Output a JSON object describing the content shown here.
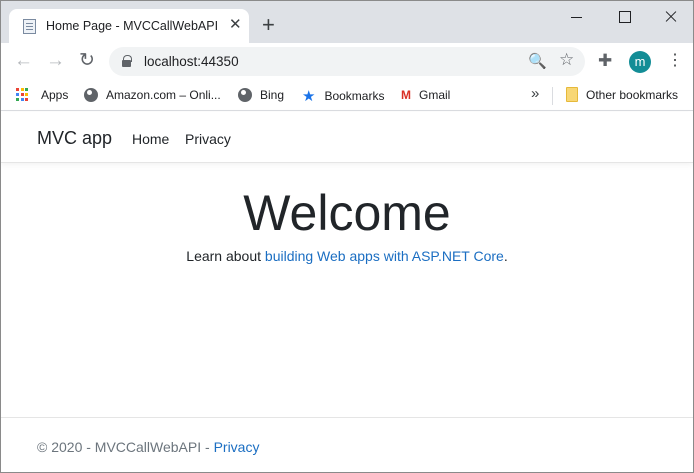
{
  "browser": {
    "tab_title": "Home Page - MVCCallWebAPI",
    "tab_close": "✕",
    "new_tab": "+",
    "url": "localhost:44350",
    "profile_initial": "m",
    "back": "←",
    "forward": "→",
    "reload": "↻",
    "zoom": "🔍",
    "star": "☆",
    "extensions": "✚",
    "menu": "⋮",
    "bookmarks": {
      "apps": "Apps",
      "amazon": "Amazon.com – Onli...",
      "bing": "Bing",
      "bookmarks": "Bookmarks",
      "gmail": "Gmail",
      "more": "»",
      "other": "Other bookmarks"
    },
    "icons": {
      "apps": "apps-grid-icon",
      "amazon": "globe-icon",
      "bing": "globe-icon",
      "bookmarks": "star-icon",
      "gmail": "gmail-icon",
      "other": "folder-icon"
    },
    "apps_colors": [
      "#ea4335",
      "#fbbc04",
      "#34a853",
      "#4285f4",
      "#ea4335",
      "#fbbc04",
      "#34a853",
      "#4285f4",
      "#ea4335"
    ]
  },
  "site": {
    "brand": "MVC app",
    "nav": {
      "home": "Home",
      "privacy": "Privacy"
    },
    "heading": "Welcome",
    "lead_prefix": "Learn about ",
    "lead_link": "building Web apps with ASP.NET Core",
    "lead_suffix": ".",
    "footer_text": "© 2020 - MVCCallWebAPI - ",
    "footer_link": "Privacy",
    "link_color": "#1b6ec2"
  }
}
